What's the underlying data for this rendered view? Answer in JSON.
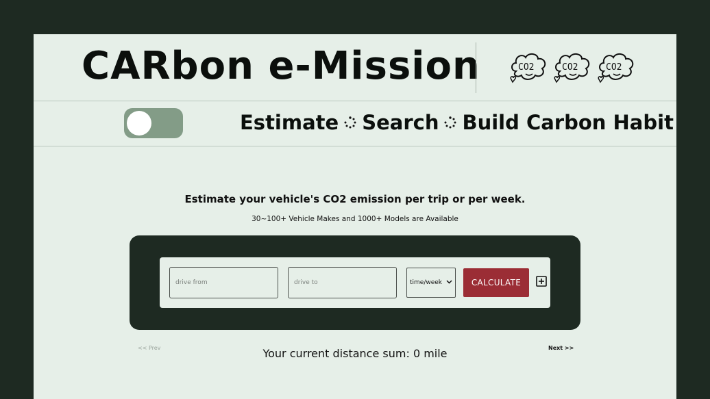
{
  "header": {
    "title": "CARbon e-Mission",
    "co2_icons": [
      "CO2",
      "CO2",
      "CO2"
    ]
  },
  "nav": {
    "toggle_state": "off",
    "links": [
      "Estimate",
      "Search",
      "Build Carbon Habit"
    ]
  },
  "main": {
    "headline": "Estimate your vehicle's CO2 emission per trip or per week.",
    "subline": "30~100+ Vehicle Makes and 1000+ Models are Available"
  },
  "form": {
    "from_placeholder": "drive from",
    "to_placeholder": "drive to",
    "frequency_selected": "time/week",
    "calculate_label": "CALCULATE"
  },
  "footer": {
    "prev_label": "<< Prev",
    "next_label": "Next >>",
    "distance_text": "Your current distance sum: 0 mile"
  },
  "colors": {
    "background": "#1e2a22",
    "panel": "#e6efe8",
    "toggle": "#839c87",
    "button": "#9b2d35"
  }
}
